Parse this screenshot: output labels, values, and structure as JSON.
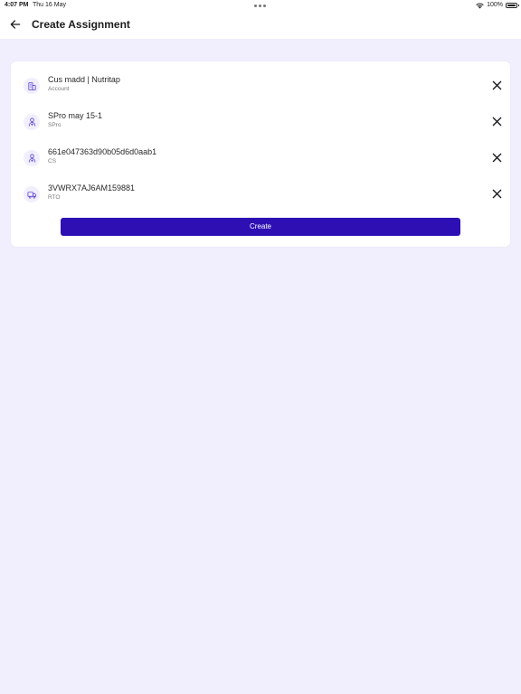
{
  "status_bar": {
    "time": "4:07 PM",
    "date": "Thu 16 May",
    "battery": "100%",
    "icons": [
      "wifi-icon",
      "battery-icon"
    ]
  },
  "header": {
    "back_icon": "arrow-left-icon",
    "title": "Create Assignment"
  },
  "assignment": {
    "items": [
      {
        "title": "Cus madd | Nutritap",
        "subtitle": "Account",
        "icon": "building-icon"
      },
      {
        "title": "SPro may 15-1",
        "subtitle": "SPro",
        "icon": "person-icon"
      },
      {
        "title": "661e047363d90b05d6d0aab1",
        "subtitle": "CS",
        "icon": "person-icon"
      },
      {
        "title": "3VWRX7AJ6AM159881",
        "subtitle": "RTO",
        "icon": "truck-icon"
      }
    ],
    "remove_icon": "close-icon",
    "create_label": "Create"
  },
  "colors": {
    "background": "#f1effd",
    "surface": "#ffffff",
    "primary": "#2e0fb4",
    "icon_accent": "#5b45d6"
  }
}
